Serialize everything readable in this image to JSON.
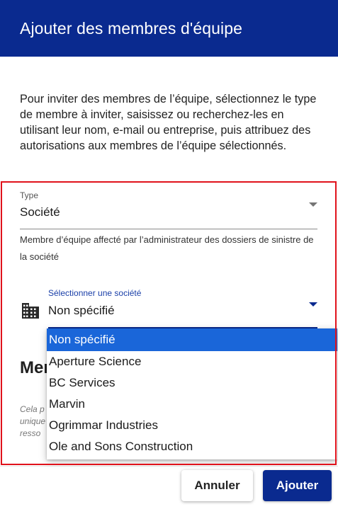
{
  "dialog": {
    "title": "Ajouter des membres d'équipe",
    "intro": "Pour inviter des membres de l’équipe, sélectionnez le type de membre à inviter, saisissez ou recherchez-les en utilisant leur nom, e-mail ou entreprise, puis attribuez des autorisations aux membres de l’équipe sélectionnés."
  },
  "type_field": {
    "label": "Type",
    "value": "Société",
    "helper": "Membre d’équipe affecté par l’administrateur des dossiers de sinistre de la société"
  },
  "company_field": {
    "label": "Sélectionner une société",
    "value": "Non spécifié",
    "icon": "building-icon",
    "options": [
      "Non spécifié",
      "Aperture Science",
      "BC Services",
      "Marvin",
      "Ogrimmar Industries",
      "Ole and Sons Construction"
    ],
    "selected_index": 0
  },
  "members_section": {
    "heading": "Mem",
    "note": "Cela p unique resso"
  },
  "footer": {
    "cancel_label": "Annuler",
    "add_label": "Ajouter"
  },
  "colors": {
    "header_bg": "#0a2a8f",
    "primary": "#0a2a8f",
    "selected_option": "#1a66d9",
    "focus_outline": "#e0121b"
  }
}
